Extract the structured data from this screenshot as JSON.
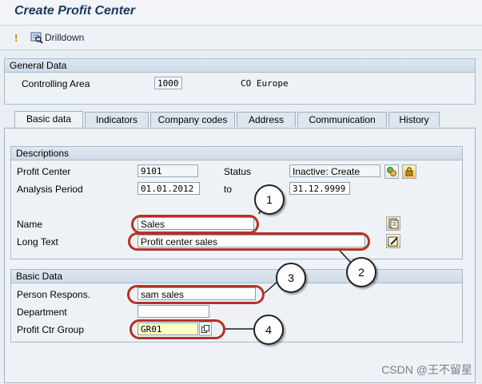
{
  "window": {
    "title": "Create Profit Center"
  },
  "toolbar": {
    "drilldown_label": "Drilldown"
  },
  "general_data": {
    "header": "General Data",
    "controlling_area_label": "Controlling Area",
    "controlling_area_value": "1000",
    "controlling_area_desc": "CO Europe"
  },
  "tabs": [
    {
      "label": "Basic data",
      "active": true
    },
    {
      "label": "Indicators",
      "active": false
    },
    {
      "label": "Company codes",
      "active": false
    },
    {
      "label": "Address",
      "active": false
    },
    {
      "label": "Communication",
      "active": false
    },
    {
      "label": "History",
      "active": false
    }
  ],
  "descriptions": {
    "header": "Descriptions",
    "profit_center_label": "Profit Center",
    "profit_center_value": "9101",
    "status_label": "Status",
    "status_value": "Inactive: Create",
    "analysis_period_label": "Analysis Period",
    "analysis_from": "01.01.2012",
    "to_label": "to",
    "analysis_to": "31.12.9999",
    "name_label": "Name",
    "name_value": "Sales",
    "long_text_label": "Long Text",
    "long_text_value": "Profit center sales"
  },
  "basic_data": {
    "header": "Basic Data",
    "person_resp_label": "Person Respons.",
    "person_resp_value": "sam sales",
    "department_label": "Department",
    "department_value": "",
    "group_label": "Profit Ctr Group",
    "group_value": "GR01"
  },
  "callouts": [
    "1",
    "2",
    "3",
    "4"
  ],
  "watermark": "CSDN @王不留星",
  "colors": {
    "annotation": "#b53224",
    "title": "#1c3a60"
  }
}
